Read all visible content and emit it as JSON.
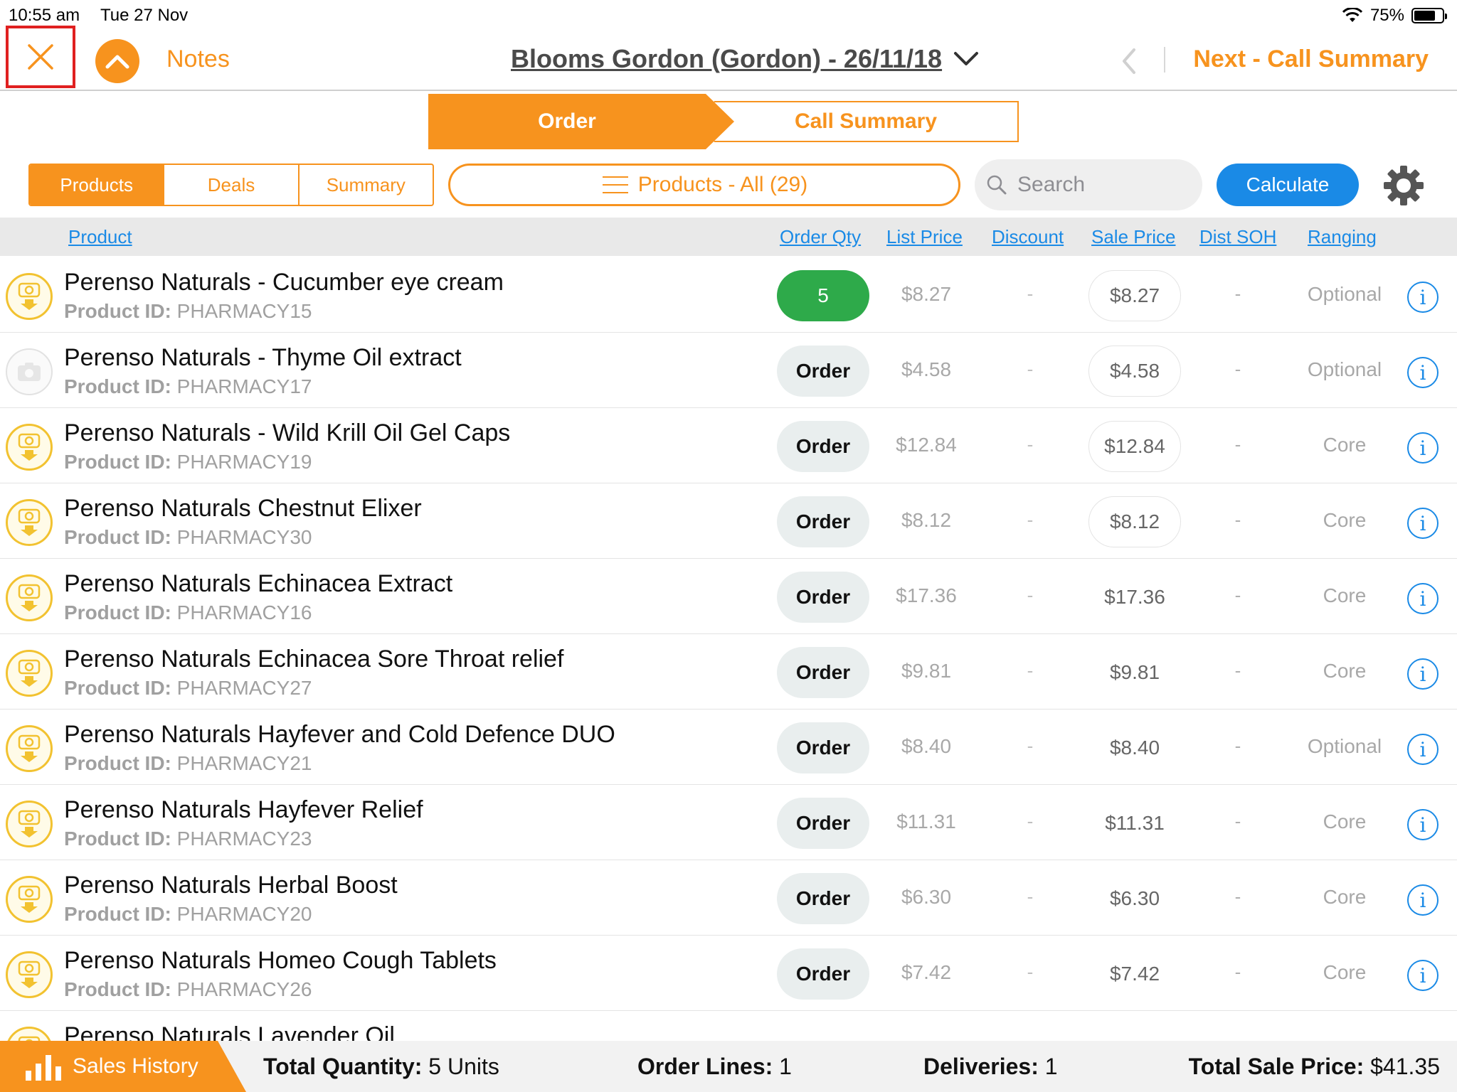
{
  "status": {
    "time": "10:55 am",
    "date": "Tue 27 Nov",
    "battery": "75%",
    "battery_level": 0.75
  },
  "nav": {
    "notes_label": "Notes",
    "title": "Blooms Gordon (Gordon) - 26/11/18",
    "next_label": "Next - Call Summary"
  },
  "steps": {
    "order": "Order",
    "call_summary": "Call Summary"
  },
  "toolbar": {
    "tabs": [
      "Products",
      "Deals",
      "Summary"
    ],
    "active_tab": "Products",
    "filter_label": "Products - All (29)",
    "search_placeholder": "Search",
    "calculate_label": "Calculate"
  },
  "columns": {
    "product": "Product",
    "order_qty": "Order Qty",
    "list_price": "List Price",
    "discount": "Discount",
    "sale_price": "Sale Price",
    "dist_soh": "Dist SOH",
    "ranging": "Ranging"
  },
  "id_label": "Product ID:",
  "rows": [
    {
      "name": "Perenso Naturals - Cucumber eye cream",
      "id": "PHARMACY15",
      "qty": "5",
      "qty_set": true,
      "list": "$8.27",
      "discount": "-",
      "sale": "$8.27",
      "sale_editable": true,
      "soh": "-",
      "ranging": "Optional",
      "has_image": true
    },
    {
      "name": "Perenso Naturals - Thyme Oil extract",
      "id": "PHARMACY17",
      "qty": "Order",
      "qty_set": false,
      "list": "$4.58",
      "discount": "-",
      "sale": "$4.58",
      "sale_editable": true,
      "soh": "-",
      "ranging": "Optional",
      "has_image": false
    },
    {
      "name": "Perenso Naturals - Wild Krill Oil Gel Caps",
      "id": "PHARMACY19",
      "qty": "Order",
      "qty_set": false,
      "list": "$12.84",
      "discount": "-",
      "sale": "$12.84",
      "sale_editable": true,
      "soh": "-",
      "ranging": "Core",
      "has_image": true
    },
    {
      "name": "Perenso Naturals Chestnut Elixer",
      "id": "PHARMACY30",
      "qty": "Order",
      "qty_set": false,
      "list": "$8.12",
      "discount": "-",
      "sale": "$8.12",
      "sale_editable": true,
      "soh": "-",
      "ranging": "Core",
      "has_image": true
    },
    {
      "name": "Perenso Naturals Echinacea Extract",
      "id": "PHARMACY16",
      "qty": "Order",
      "qty_set": false,
      "list": "$17.36",
      "discount": "-",
      "sale": "$17.36",
      "sale_editable": false,
      "soh": "-",
      "ranging": "Core",
      "has_image": true
    },
    {
      "name": "Perenso Naturals Echinacea Sore Throat relief",
      "id": "PHARMACY27",
      "qty": "Order",
      "qty_set": false,
      "list": "$9.81",
      "discount": "-",
      "sale": "$9.81",
      "sale_editable": false,
      "soh": "-",
      "ranging": "Core",
      "has_image": true
    },
    {
      "name": "Perenso Naturals Hayfever and Cold Defence DUO",
      "id": "PHARMACY21",
      "qty": "Order",
      "qty_set": false,
      "list": "$8.40",
      "discount": "-",
      "sale": "$8.40",
      "sale_editable": false,
      "soh": "-",
      "ranging": "Optional",
      "has_image": true
    },
    {
      "name": "Perenso Naturals Hayfever Relief",
      "id": "PHARMACY23",
      "qty": "Order",
      "qty_set": false,
      "list": "$11.31",
      "discount": "-",
      "sale": "$11.31",
      "sale_editable": false,
      "soh": "-",
      "ranging": "Core",
      "has_image": true
    },
    {
      "name": "Perenso Naturals Herbal Boost",
      "id": "PHARMACY20",
      "qty": "Order",
      "qty_set": false,
      "list": "$6.30",
      "discount": "-",
      "sale": "$6.30",
      "sale_editable": false,
      "soh": "-",
      "ranging": "Core",
      "has_image": true
    },
    {
      "name": "Perenso Naturals Homeo Cough Tablets",
      "id": "PHARMACY26",
      "qty": "Order",
      "qty_set": false,
      "list": "$7.42",
      "discount": "-",
      "sale": "$7.42",
      "sale_editable": false,
      "soh": "-",
      "ranging": "Core",
      "has_image": true
    },
    {
      "name": "Perenso Naturals Lavender Oil",
      "id": "",
      "qty": "",
      "qty_set": false,
      "list": "",
      "discount": "",
      "sale": "",
      "sale_editable": false,
      "soh": "",
      "ranging": "",
      "has_image": true
    }
  ],
  "footer": {
    "sales_history": "Sales History",
    "total_qty_label": "Total Quantity:",
    "total_qty_value": "5 Units",
    "order_lines_label": "Order Lines:",
    "order_lines_value": "1",
    "deliveries_label": "Deliveries:",
    "deliveries_value": "1",
    "total_sale_label": "Total Sale Price:",
    "total_sale_value": "$41.35"
  },
  "colors": {
    "accent": "#f7931e",
    "blue": "#1a8ae6",
    "green": "#2eaa4a",
    "highlight": "#e02020"
  }
}
